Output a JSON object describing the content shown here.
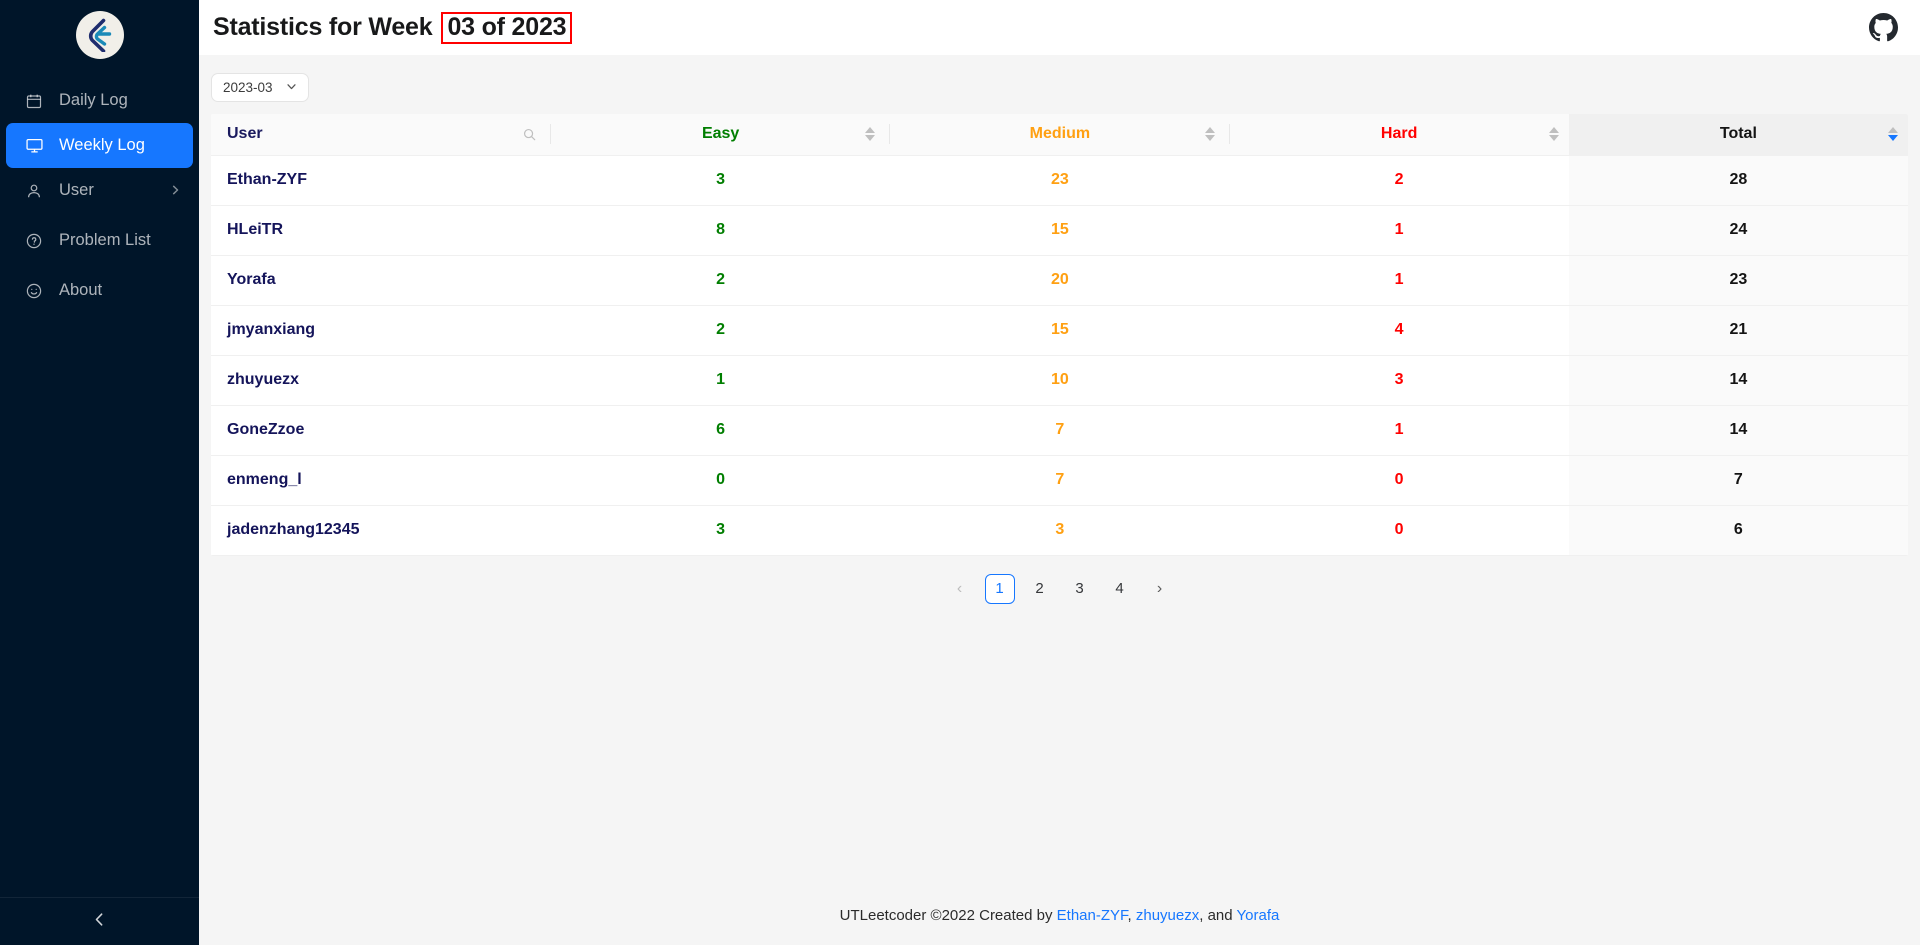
{
  "sidebar": {
    "logo": "leetcode-logo",
    "items": [
      {
        "label": "Daily Log",
        "icon": "calendar-icon",
        "active": false,
        "expandable": false
      },
      {
        "label": "Weekly Log",
        "icon": "monitor-icon",
        "active": true,
        "expandable": false
      },
      {
        "label": "User",
        "icon": "user-icon",
        "active": false,
        "expandable": true
      },
      {
        "label": "Problem List",
        "icon": "question-circle-icon",
        "active": false,
        "expandable": false
      },
      {
        "label": "About",
        "icon": "smile-circle-icon",
        "active": false,
        "expandable": false
      }
    ],
    "collapse_icon": "chevron-left-icon"
  },
  "header": {
    "title_prefix": "Statistics for Week",
    "title_highlight": "03 of 2023",
    "github_icon": "github-icon"
  },
  "filters": {
    "month_value": "2023-03",
    "chevron_icon": "chevron-down-icon"
  },
  "table": {
    "columns": [
      {
        "key": "user",
        "label": "User",
        "align": "left",
        "sortable": false,
        "searchable": true,
        "color": "#1a1a5e"
      },
      {
        "key": "easy",
        "label": "Easy",
        "align": "center",
        "sortable": true,
        "searchable": false,
        "color": "#007e00"
      },
      {
        "key": "medium",
        "label": "Medium",
        "align": "center",
        "sortable": true,
        "searchable": false,
        "color": "#ffa012"
      },
      {
        "key": "hard",
        "label": "Hard",
        "align": "center",
        "sortable": true,
        "searchable": false,
        "color": "#ff0000"
      },
      {
        "key": "total",
        "label": "Total",
        "align": "center",
        "sortable": true,
        "searchable": false,
        "color": "#141414",
        "sorted": "descend"
      }
    ],
    "rows": [
      {
        "user": "Ethan-ZYF",
        "easy": "3",
        "medium": "23",
        "hard": "2",
        "total": "28"
      },
      {
        "user": "HLeiTR",
        "easy": "8",
        "medium": "15",
        "hard": "1",
        "total": "24"
      },
      {
        "user": "Yorafa",
        "easy": "2",
        "medium": "20",
        "hard": "1",
        "total": "23"
      },
      {
        "user": "jmyanxiang",
        "easy": "2",
        "medium": "15",
        "hard": "4",
        "total": "21"
      },
      {
        "user": "zhuyuezx",
        "easy": "1",
        "medium": "10",
        "hard": "3",
        "total": "14"
      },
      {
        "user": "GoneZzoe",
        "easy": "6",
        "medium": "7",
        "hard": "1",
        "total": "14"
      },
      {
        "user": "enmeng_l",
        "easy": "0",
        "medium": "7",
        "hard": "0",
        "total": "7"
      },
      {
        "user": "jadenzhang12345",
        "easy": "3",
        "medium": "3",
        "hard": "0",
        "total": "6"
      }
    ]
  },
  "pagination": {
    "prev_label": "‹",
    "next_label": "›",
    "pages": [
      "1",
      "2",
      "3",
      "4"
    ],
    "current": "1"
  },
  "footer": {
    "text_before": "UTLeetcoder ©2022 Created by ",
    "link1": "Ethan-ZYF",
    "sep1": ", ",
    "link2": "zhuyuezx",
    "sep2": ", and ",
    "link3": "Yorafa"
  },
  "colors": {
    "sidebar_bg": "#001529",
    "accent": "#1677ff",
    "easy": "#007e00",
    "medium": "#ffa012",
    "hard": "#ff0000",
    "highlight_box": "#ff0000"
  }
}
